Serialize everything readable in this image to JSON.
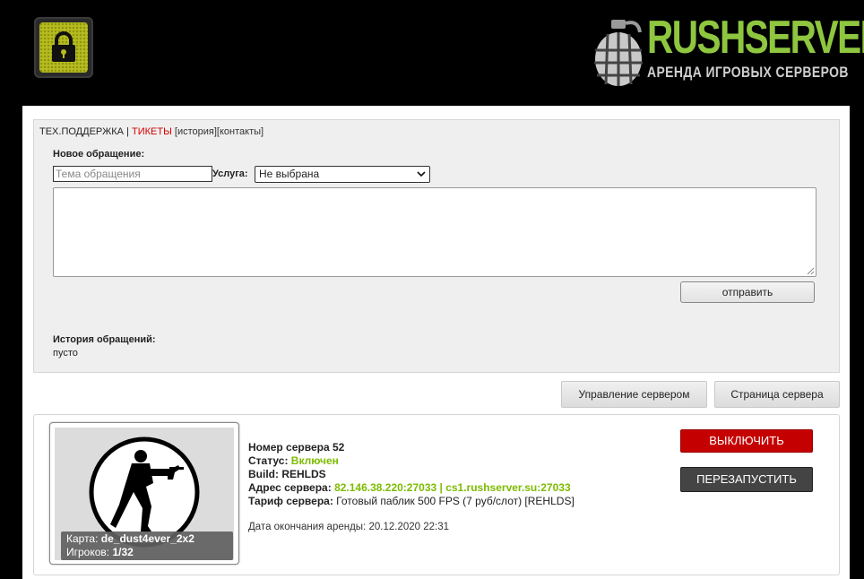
{
  "header": {
    "lock_icon": "lock-icon",
    "brand": "RUSHSERVER",
    "tagline": "АРЕНДА ИГРОВЫХ СЕРВЕРОВ",
    "colors": {
      "brand": "#8ec63f",
      "lock_badge": "#b7bd1f"
    }
  },
  "support": {
    "nav": {
      "section": "ТЕХ.ПОДДЕРЖКА",
      "separator": " | ",
      "active": "ТИКЕТЫ",
      "history": "[история]",
      "contacts": "[контакты]"
    },
    "new_request_label": "Новое обращение:",
    "subject_placeholder": "Тема обращения",
    "subject_value": "",
    "service_label": "Услуга:",
    "service_selected": "Не выбрана",
    "message_value": "",
    "send_button": "отправить",
    "history_label": "История обращений:",
    "history_empty": "пусто"
  },
  "actions": {
    "manage": "Управление сервером",
    "page": "Страница сервера"
  },
  "server": {
    "map_label": "Карта:",
    "map_value": "de_dust4ever_2x2",
    "players_label": "Игроков:",
    "players_value": "1/32",
    "number_label": "Номер сервера",
    "number_value": "52",
    "status_label": "Статус:",
    "status_value": "Включен",
    "build_label": "Build:",
    "build_value": "REHLDS",
    "address_label": "Адрес сервера:",
    "address_value": "82.146.38.220:27033 | cs1.rushserver.su:27033",
    "tariff_label": "Тариф сервера:",
    "tariff_value": "Готовый паблик 500 FPS (7 руб/слот) [REHLDS]",
    "expiry_label": "Дата окончания аренды:",
    "expiry_value": "20.12.2020 22:31",
    "off_button": "ВЫКЛЮЧИТЬ",
    "restart_button": "ПЕРЕЗАПУСТИТЬ",
    "colors": {
      "status": "#7dbb00",
      "off": "#c50000",
      "restart": "#444444"
    }
  }
}
